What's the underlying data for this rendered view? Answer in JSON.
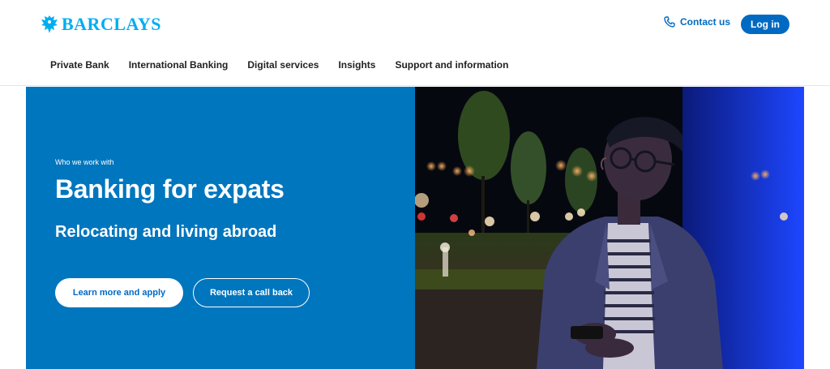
{
  "brand": {
    "name": "BARCLAYS",
    "logo_icon": "eagle-icon",
    "color": "#00aeef"
  },
  "header": {
    "contact_label": "Contact us",
    "contact_icon": "phone-icon",
    "login_label": "Log in",
    "accent": "#006ac3"
  },
  "nav": {
    "items": [
      {
        "label": "Private Bank"
      },
      {
        "label": "International Banking"
      },
      {
        "label": "Digital services"
      },
      {
        "label": "Insights"
      },
      {
        "label": "Support and information"
      }
    ]
  },
  "hero": {
    "eyebrow": "Who we work with",
    "title": "Banking for expats",
    "subtitle": "Relocating and living abroad",
    "primary_cta": "Learn more and apply",
    "secondary_cta": "Request a call back",
    "background_color": "#0076be"
  }
}
